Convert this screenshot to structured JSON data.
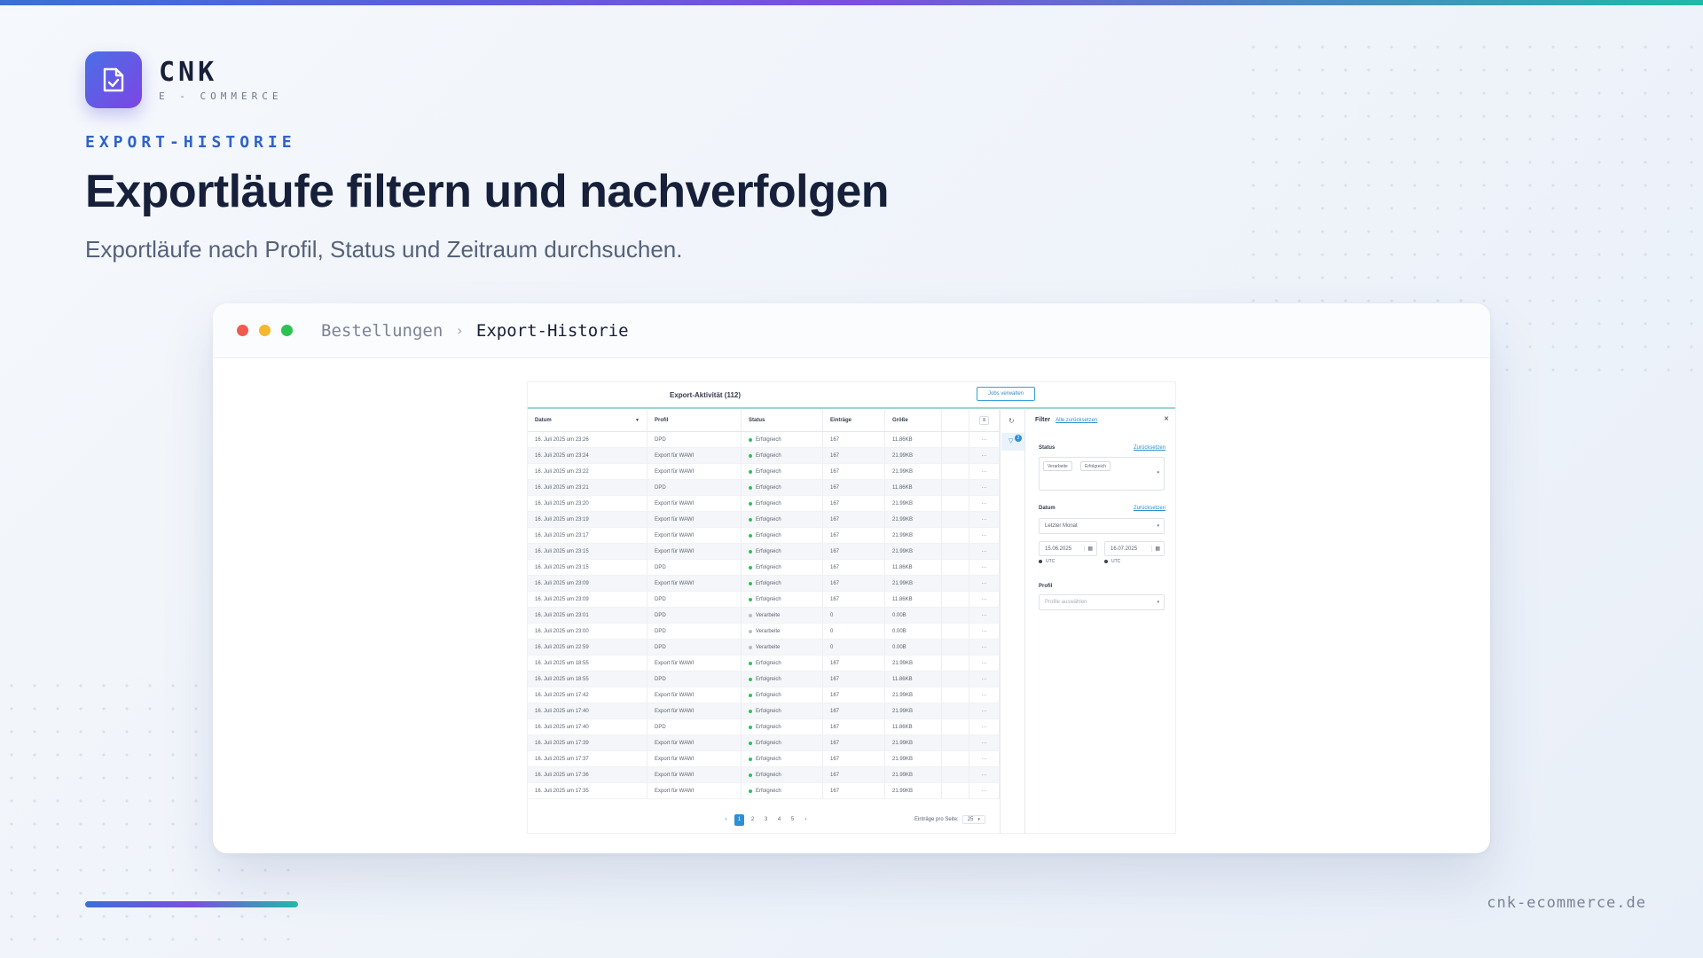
{
  "brand": {
    "name": "CNK",
    "tagline": "E - COMMERCE",
    "url": "cnk-ecommerce.de"
  },
  "hero": {
    "eyebrow": "EXPORT-HISTORIE",
    "title": "Exportläufe filtern und nachverfolgen",
    "subtitle": "Exportläufe nach Profil, Status und Zeitraum durchsuchen."
  },
  "window": {
    "breadcrumb": [
      "Bestellungen",
      "Export-Historie"
    ],
    "separator": "›"
  },
  "app": {
    "title": "Export-Aktivität (112)",
    "jobs_button": "Jobs verwalten",
    "columns": [
      "Datum",
      "Profil",
      "Status",
      "Einträge",
      "Größe"
    ],
    "rows": [
      [
        "16. Juli 2025 um 23:26",
        "DPD",
        "Erfolgreich",
        "167",
        "11.86KB"
      ],
      [
        "16. Juli 2025 um 23:24",
        "Export für WAWI",
        "Erfolgreich",
        "167",
        "21.99KB"
      ],
      [
        "16. Juli 2025 um 23:22",
        "Export für WAWI",
        "Erfolgreich",
        "167",
        "21.99KB"
      ],
      [
        "16. Juli 2025 um 23:21",
        "DPD",
        "Erfolgreich",
        "167",
        "11.86KB"
      ],
      [
        "16. Juli 2025 um 23:20",
        "Export für WAWI",
        "Erfolgreich",
        "167",
        "21.99KB"
      ],
      [
        "16. Juli 2025 um 23:19",
        "Export für WAWI",
        "Erfolgreich",
        "167",
        "21.99KB"
      ],
      [
        "16. Juli 2025 um 23:17",
        "Export für WAWI",
        "Erfolgreich",
        "167",
        "21.99KB"
      ],
      [
        "16. Juli 2025 um 23:15",
        "Export für WAWI",
        "Erfolgreich",
        "167",
        "21.99KB"
      ],
      [
        "16. Juli 2025 um 23:15",
        "DPD",
        "Erfolgreich",
        "167",
        "11.86KB"
      ],
      [
        "16. Juli 2025 um 23:09",
        "Export für WAWI",
        "Erfolgreich",
        "167",
        "21.99KB"
      ],
      [
        "16. Juli 2025 um 23:09",
        "DPD",
        "Erfolgreich",
        "167",
        "11.86KB"
      ],
      [
        "16. Juli 2025 um 23:01",
        "DPD",
        "Verarbeite",
        "0",
        "0.00B"
      ],
      [
        "16. Juli 2025 um 23:00",
        "DPD",
        "Verarbeite",
        "0",
        "0.00B"
      ],
      [
        "16. Juli 2025 um 22:59",
        "DPD",
        "Verarbeite",
        "0",
        "0.00B"
      ],
      [
        "16. Juli 2025 um 18:55",
        "Export für WAWI",
        "Erfolgreich",
        "167",
        "21.99KB"
      ],
      [
        "16. Juli 2025 um 18:55",
        "DPD",
        "Erfolgreich",
        "167",
        "11.86KB"
      ],
      [
        "16. Juli 2025 um 17:42",
        "Export für WAWI",
        "Erfolgreich",
        "167",
        "21.99KB"
      ],
      [
        "16. Juli 2025 um 17:40",
        "Export für WAWI",
        "Erfolgreich",
        "167",
        "21.99KB"
      ],
      [
        "16. Juli 2025 um 17:40",
        "DPD",
        "Erfolgreich",
        "167",
        "11.86KB"
      ],
      [
        "16. Juli 2025 um 17:39",
        "Export für WAWI",
        "Erfolgreich",
        "167",
        "21.99KB"
      ],
      [
        "16. Juli 2025 um 17:37",
        "Export für WAWI",
        "Erfolgreich",
        "167",
        "21.99KB"
      ],
      [
        "16. Juli 2025 um 17:36",
        "Export für WAWI",
        "Erfolgreich",
        "167",
        "21.99KB"
      ],
      [
        "16. Juli 2025 um 17:35",
        "Export für WAWI",
        "Erfolgreich",
        "167",
        "21.99KB"
      ]
    ],
    "row_more": "···",
    "pagination": {
      "pages": [
        "1",
        "2",
        "3",
        "4",
        "5"
      ],
      "active": "1",
      "prev": "‹",
      "next": "›",
      "per_page_label": "Einträge pro Seite:",
      "per_page_value": "25"
    },
    "filter": {
      "title": "Filter",
      "reset_all": "Alle zurücksetzen",
      "close": "×",
      "status_label": "Status",
      "status_reset": "Zurücksetzen",
      "status_chips": [
        "Verarbeite",
        "Erfolgreich"
      ],
      "date_label": "Datum",
      "date_reset": "Zurücksetzen",
      "date_preset": "Letzter Monat",
      "date_from": "15.06.2025",
      "date_to": "16.07.2025",
      "timezone": "UTC",
      "profile_label": "Profil",
      "profile_placeholder": "Profile auswählen",
      "active_filter_count": "2"
    },
    "colors": {
      "success": "#2fc25b",
      "processing": "#b8bec8",
      "accent": "#2d8fd5"
    }
  }
}
